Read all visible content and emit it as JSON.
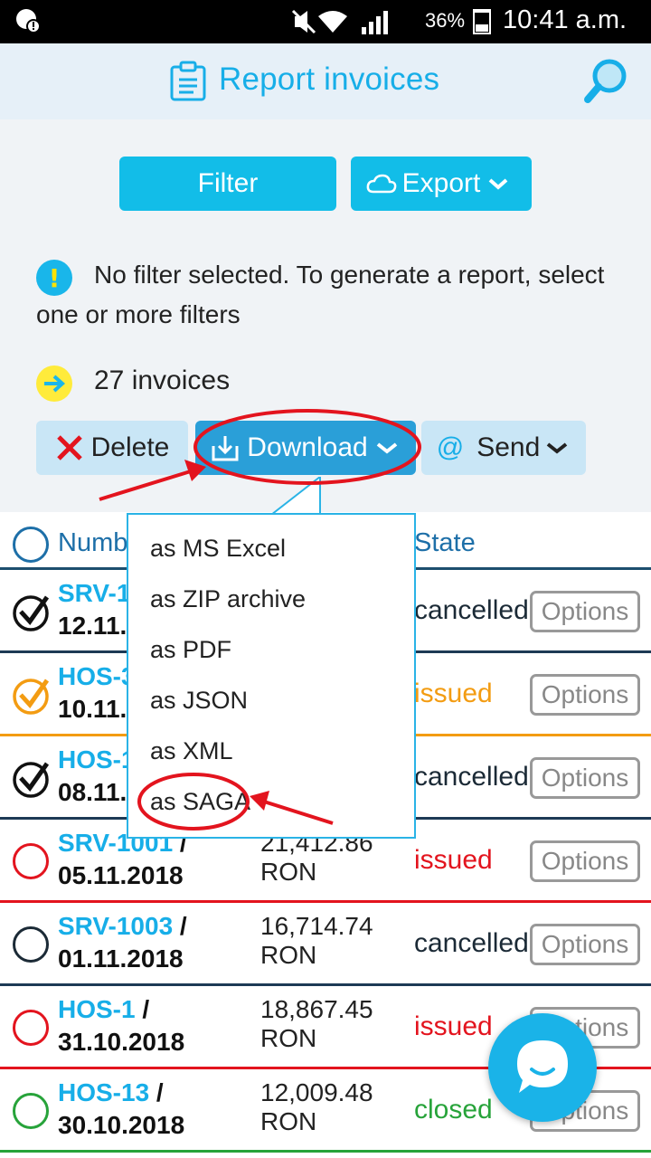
{
  "status_bar": {
    "battery": "36%",
    "time": "10:41 a.m."
  },
  "app_bar": {
    "title": "Report invoices",
    "icon": "clipboard-icon",
    "action_icon": "search-icon"
  },
  "toolbar": {
    "filter_label": "Filter",
    "export_label": "Export"
  },
  "notice": {
    "text": "No filter selected. To generate a report, select one or more filters"
  },
  "summary": {
    "count_text": "27 invoices"
  },
  "actions": {
    "delete_label": "Delete",
    "download_label": "Download",
    "send_label": "Send"
  },
  "table": {
    "header_number": "Numb",
    "header_state": "State",
    "rows": [
      {
        "number": "SRV-1",
        "date": "12.11.2",
        "amount_value": "",
        "amount_currency": "",
        "state": "cancelled",
        "state_color": "#1b2a36",
        "marker": "check",
        "marker_color": "#111111",
        "border_color": "#1d3a55",
        "options": "Options"
      },
      {
        "number": "HOS-3",
        "date": "10.11.2",
        "amount_value": "",
        "amount_currency": "",
        "state": "issued",
        "state_color": "#f39c12",
        "marker": "check",
        "marker_color": "#f39c12",
        "border_color": "#f39c12",
        "options": "Options"
      },
      {
        "number": "HOS-1",
        "date": "08.11.",
        "amount_value": "",
        "amount_currency": "",
        "state": "cancelled",
        "state_color": "#1b2a36",
        "marker": "check",
        "marker_color": "#111111",
        "border_color": "#1d3a55",
        "options": "Options"
      },
      {
        "number": "SRV-1001",
        "date": "05.11.2018",
        "amount_value": "21,412.86",
        "amount_currency": "RON",
        "state": "issued",
        "state_color": "#e3141e",
        "marker": "circle",
        "marker_color": "#e3141e",
        "border_color": "#e3141e",
        "options": "Options"
      },
      {
        "number": "SRV-1003",
        "date": "01.11.2018",
        "amount_value": "16,714.74",
        "amount_currency": "RON",
        "state": "cancelled",
        "state_color": "#1b2a36",
        "marker": "circle",
        "marker_color": "#1b2a36",
        "border_color": "#1d3a55",
        "options": "Options"
      },
      {
        "number": "HOS-1",
        "date": "31.10.2018",
        "amount_value": "18,867.45",
        "amount_currency": "RON",
        "state": "issued",
        "state_color": "#e3141e",
        "marker": "circle",
        "marker_color": "#e3141e",
        "border_color": "#e3141e",
        "options": "Options"
      },
      {
        "number": "HOS-13",
        "date": "30.10.2018",
        "amount_value": "12,009.48",
        "amount_currency": "RON",
        "state": "closed",
        "state_color": "#27a33a",
        "marker": "circle",
        "marker_color": "#27a33a",
        "border_color": "#27a33a",
        "options": "Options"
      }
    ]
  },
  "download_menu": {
    "items": [
      "as MS Excel",
      "as ZIP archive",
      "as PDF",
      "as JSON",
      "as XML",
      "as SAGA"
    ]
  },
  "colors": {
    "accent": "#12bde8",
    "appbar_bg": "#e6f0f8",
    "annotation": "#e3141e"
  }
}
